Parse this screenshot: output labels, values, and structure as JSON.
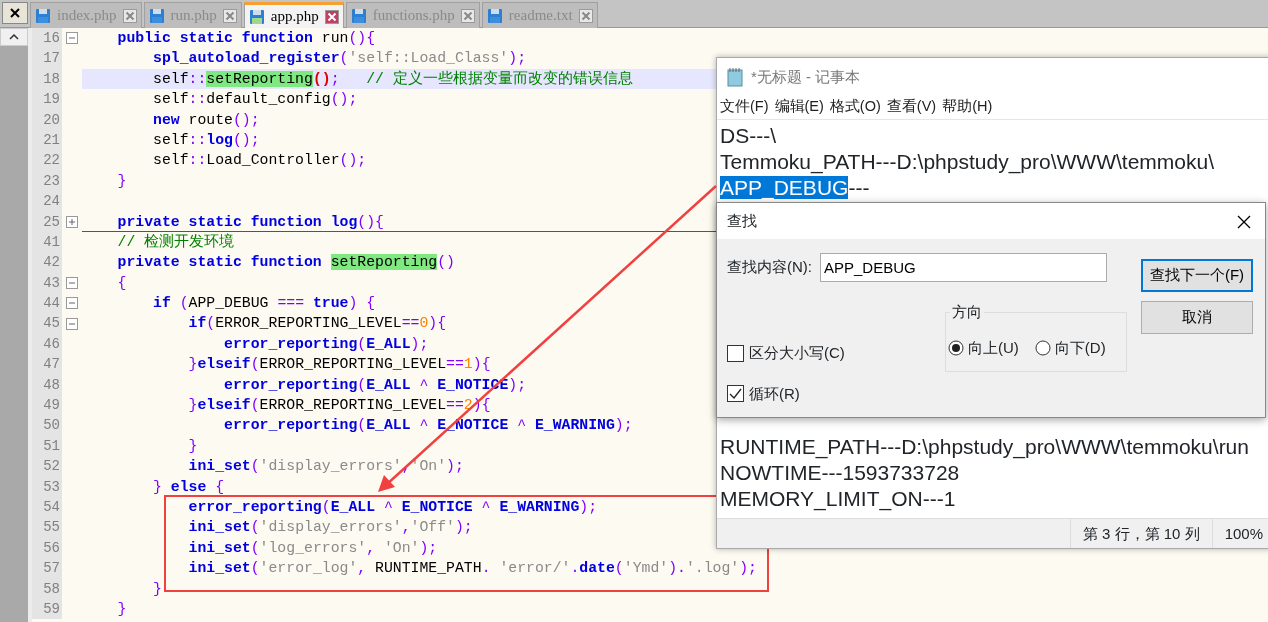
{
  "tabs": [
    {
      "label": "index.php",
      "selected": false
    },
    {
      "label": "run.php",
      "selected": false
    },
    {
      "label": "app.php",
      "selected": true
    },
    {
      "label": "functions.php",
      "selected": false
    },
    {
      "label": "readme.txt",
      "selected": false
    }
  ],
  "editor": {
    "lines": [
      {
        "number": "16",
        "selected": false,
        "fold_expanded": true,
        "tokens": [
          {
            "kind": "kw",
            "text": "    public static function"
          },
          {
            "kind": "plain",
            "text": " run"
          },
          {
            "kind": "op",
            "text": "(){"
          }
        ]
      },
      {
        "number": "17",
        "selected": false,
        "tokens": [
          {
            "kind": "fn",
            "text": "        spl_autoload_register"
          },
          {
            "kind": "op",
            "text": "("
          },
          {
            "kind": "str",
            "text": "'self::Load_Class'"
          },
          {
            "kind": "op",
            "text": ");"
          }
        ]
      },
      {
        "number": "18",
        "selected": true,
        "tokens": [
          {
            "kind": "plain",
            "text": "        self"
          },
          {
            "kind": "op",
            "text": "::"
          },
          {
            "kind": "match",
            "text": "setReporting"
          },
          {
            "kind": "brace",
            "text": "()"
          },
          {
            "kind": "op",
            "text": ";"
          },
          {
            "kind": "comment",
            "text": "   // 定义一些根据变量而改变的错误信息"
          }
        ]
      },
      {
        "number": "19",
        "selected": false,
        "tokens": [
          {
            "kind": "plain",
            "text": "        self"
          },
          {
            "kind": "op",
            "text": "::"
          },
          {
            "kind": "plain",
            "text": "default_config"
          },
          {
            "kind": "op",
            "text": "();"
          }
        ]
      },
      {
        "number": "20",
        "selected": false,
        "tokens": [
          {
            "kind": "kw",
            "text": "        new"
          },
          {
            "kind": "plain",
            "text": " route"
          },
          {
            "kind": "op",
            "text": "();"
          }
        ]
      },
      {
        "number": "21",
        "selected": false,
        "tokens": [
          {
            "kind": "plain",
            "text": "        self"
          },
          {
            "kind": "op",
            "text": "::"
          },
          {
            "kind": "fn",
            "text": "log"
          },
          {
            "kind": "op",
            "text": "();"
          }
        ]
      },
      {
        "number": "22",
        "selected": false,
        "tokens": [
          {
            "kind": "plain",
            "text": "        self"
          },
          {
            "kind": "op",
            "text": "::"
          },
          {
            "kind": "plain",
            "text": "Load_Controller"
          },
          {
            "kind": "op",
            "text": "();"
          }
        ]
      },
      {
        "number": "23",
        "selected": false,
        "tokens": [
          {
            "kind": "op",
            "text": "    }"
          }
        ]
      },
      {
        "number": "24",
        "selected": false
      },
      {
        "number": "25",
        "selected": false,
        "fold_expanded": false,
        "tokens": [
          {
            "kind": "kw",
            "text": "    private static function "
          },
          {
            "kind": "fn",
            "text": "log"
          },
          {
            "kind": "op",
            "text": "(){"
          }
        ]
      },
      {
        "number": "41",
        "selected": false,
        "tokens": [
          {
            "kind": "comment",
            "text": "    // 检测开发环境"
          }
        ]
      },
      {
        "number": "42",
        "selected": false,
        "tokens": [
          {
            "kind": "kw",
            "text": "    private static function "
          },
          {
            "kind": "match",
            "text": "setReporting"
          },
          {
            "kind": "op",
            "text": "()"
          }
        ]
      },
      {
        "number": "43",
        "selected": false,
        "fold_expanded": true,
        "tokens": [
          {
            "kind": "op",
            "text": "    {"
          }
        ]
      },
      {
        "number": "44",
        "selected": false,
        "fold_expanded": true,
        "tokens": [
          {
            "kind": "kw",
            "text": "        if "
          },
          {
            "kind": "op",
            "text": "("
          },
          {
            "kind": "plain",
            "text": "APP_DEBUG "
          },
          {
            "kind": "op",
            "text": "=== "
          },
          {
            "kind": "kw",
            "text": "true"
          },
          {
            "kind": "op",
            "text": ") {"
          }
        ]
      },
      {
        "number": "45",
        "selected": false,
        "fold_expanded": true,
        "tokens": [
          {
            "kind": "kw",
            "text": "            if"
          },
          {
            "kind": "op",
            "text": "("
          },
          {
            "kind": "plain",
            "text": "ERROR_REPORTING_LEVEL"
          },
          {
            "kind": "op",
            "text": "=="
          },
          {
            "kind": "num",
            "text": "0"
          },
          {
            "kind": "op",
            "text": "){"
          }
        ]
      },
      {
        "number": "46",
        "selected": false,
        "tokens": [
          {
            "kind": "fn",
            "text": "                error_reporting"
          },
          {
            "kind": "op",
            "text": "("
          },
          {
            "kind": "fn",
            "text": "E_ALL"
          },
          {
            "kind": "op",
            "text": ");"
          }
        ]
      },
      {
        "number": "47",
        "selected": false,
        "tokens": [
          {
            "kind": "op",
            "text": "            }"
          },
          {
            "kind": "kw",
            "text": "elseif"
          },
          {
            "kind": "op",
            "text": "("
          },
          {
            "kind": "plain",
            "text": "ERROR_REPORTING_LEVEL"
          },
          {
            "kind": "op",
            "text": "=="
          },
          {
            "kind": "num",
            "text": "1"
          },
          {
            "kind": "op",
            "text": "){"
          }
        ]
      },
      {
        "number": "48",
        "selected": false,
        "tokens": [
          {
            "kind": "fn",
            "text": "                error_reporting"
          },
          {
            "kind": "op",
            "text": "("
          },
          {
            "kind": "fn",
            "text": "E_ALL"
          },
          {
            "kind": "op",
            "text": " ^ "
          },
          {
            "kind": "fn",
            "text": "E_NOTICE"
          },
          {
            "kind": "op",
            "text": ");"
          }
        ]
      },
      {
        "number": "49",
        "selected": false,
        "tokens": [
          {
            "kind": "op",
            "text": "            }"
          },
          {
            "kind": "kw",
            "text": "elseif"
          },
          {
            "kind": "op",
            "text": "("
          },
          {
            "kind": "plain",
            "text": "ERROR_REPORTING_LEVEL"
          },
          {
            "kind": "op",
            "text": "=="
          },
          {
            "kind": "num",
            "text": "2"
          },
          {
            "kind": "op",
            "text": "){"
          }
        ]
      },
      {
        "number": "50",
        "selected": false,
        "tokens": [
          {
            "kind": "fn",
            "text": "                error_reporting"
          },
          {
            "kind": "op",
            "text": "("
          },
          {
            "kind": "fn",
            "text": "E_ALL"
          },
          {
            "kind": "op",
            "text": " ^ "
          },
          {
            "kind": "fn",
            "text": "E_NOTICE"
          },
          {
            "kind": "op",
            "text": " ^ "
          },
          {
            "kind": "fn",
            "text": "E_WARNING"
          },
          {
            "kind": "op",
            "text": ");"
          }
        ]
      },
      {
        "number": "51",
        "selected": false,
        "tokens": [
          {
            "kind": "op",
            "text": "            }"
          }
        ]
      },
      {
        "number": "52",
        "selected": false,
        "tokens": [
          {
            "kind": "fn",
            "text": "            ini_set"
          },
          {
            "kind": "op",
            "text": "("
          },
          {
            "kind": "str",
            "text": "'display_errors'"
          },
          {
            "kind": "op",
            "text": ","
          },
          {
            "kind": "str",
            "text": "'On'"
          },
          {
            "kind": "op",
            "text": ");"
          }
        ]
      },
      {
        "number": "53",
        "selected": false,
        "tokens": [
          {
            "kind": "op",
            "text": "        } "
          },
          {
            "kind": "kw",
            "text": "else"
          },
          {
            "kind": "op",
            "text": " {"
          }
        ]
      },
      {
        "number": "54",
        "selected": false,
        "tokens": [
          {
            "kind": "fn",
            "text": "            error_reporting"
          },
          {
            "kind": "op",
            "text": "("
          },
          {
            "kind": "fn",
            "text": "E_ALL"
          },
          {
            "kind": "op",
            "text": " ^ "
          },
          {
            "kind": "fn",
            "text": "E_NOTICE"
          },
          {
            "kind": "op",
            "text": " ^ "
          },
          {
            "kind": "fn",
            "text": "E_WARNING"
          },
          {
            "kind": "op",
            "text": ");"
          }
        ]
      },
      {
        "number": "55",
        "selected": false,
        "tokens": [
          {
            "kind": "fn",
            "text": "            ini_set"
          },
          {
            "kind": "op",
            "text": "("
          },
          {
            "kind": "str",
            "text": "'display_errors'"
          },
          {
            "kind": "op",
            "text": ","
          },
          {
            "kind": "str",
            "text": "'Off'"
          },
          {
            "kind": "op",
            "text": ");"
          }
        ]
      },
      {
        "number": "56",
        "selected": false,
        "tokens": [
          {
            "kind": "fn",
            "text": "            ini_set"
          },
          {
            "kind": "op",
            "text": "("
          },
          {
            "kind": "str",
            "text": "'log_errors'"
          },
          {
            "kind": "op",
            "text": ", "
          },
          {
            "kind": "str",
            "text": "'On'"
          },
          {
            "kind": "op",
            "text": ");"
          }
        ]
      },
      {
        "number": "57",
        "selected": false,
        "tokens": [
          {
            "kind": "fn",
            "text": "            ini_set"
          },
          {
            "kind": "op",
            "text": "("
          },
          {
            "kind": "str",
            "text": "'error_log'"
          },
          {
            "kind": "op",
            "text": ", "
          },
          {
            "kind": "plain",
            "text": "RUNTIME_PATH"
          },
          {
            "kind": "op",
            "text": ". "
          },
          {
            "kind": "str",
            "text": "'error/'"
          },
          {
            "kind": "op",
            "text": "."
          },
          {
            "kind": "fn",
            "text": "date"
          },
          {
            "kind": "op",
            "text": "("
          },
          {
            "kind": "str",
            "text": "'Ymd'"
          },
          {
            "kind": "op",
            "text": ")."
          },
          {
            "kind": "str",
            "text": "'.log'"
          },
          {
            "kind": "op",
            "text": ");"
          }
        ]
      },
      {
        "number": "58",
        "selected": false,
        "tokens": [
          {
            "kind": "op",
            "text": "        }"
          }
        ]
      },
      {
        "number": "59",
        "selected": false,
        "tokens": [
          {
            "kind": "op",
            "text": "    }"
          }
        ]
      }
    ]
  },
  "notepad": {
    "title": "*无标题 - 记事本",
    "menu": [
      "文件(F)",
      "编辑(E)",
      "格式(O)",
      "查看(V)",
      "帮助(H)"
    ],
    "lines_top": [
      {
        "text": "DS---\\"
      },
      {
        "text": "Temmoku_PATH---D:\\phpstudy_pro\\WWW\\temmoku\\"
      },
      {
        "selection": "APP_DEBUG",
        "text": "---"
      }
    ],
    "lines_bottom": [
      {
        "text": "RUNTIME_PATH---D:\\phpstudy_pro\\WWW\\temmoku\\run"
      },
      {
        "text": "NOWTIME---1593733728"
      },
      {
        "text": "MEMORY_LIMIT_ON---1"
      }
    ],
    "status": {
      "position": "第 3 行，第 10 列",
      "zoom": "100%"
    }
  },
  "find_dialog": {
    "title": "查找",
    "label": "查找内容(N):",
    "value": "APP_DEBUG",
    "buttons": [
      {
        "label": "查找下一个(F)",
        "default": true
      },
      {
        "label": "取消",
        "default": false
      }
    ],
    "direction": {
      "title": "方向",
      "options": [
        {
          "label": "向上(U)",
          "selected": true
        },
        {
          "label": "向下(D)",
          "selected": false
        }
      ]
    },
    "checkboxes": [
      {
        "label": "区分大小写(C)",
        "checked": false
      },
      {
        "label": "循环(R)",
        "checked": true
      }
    ]
  }
}
